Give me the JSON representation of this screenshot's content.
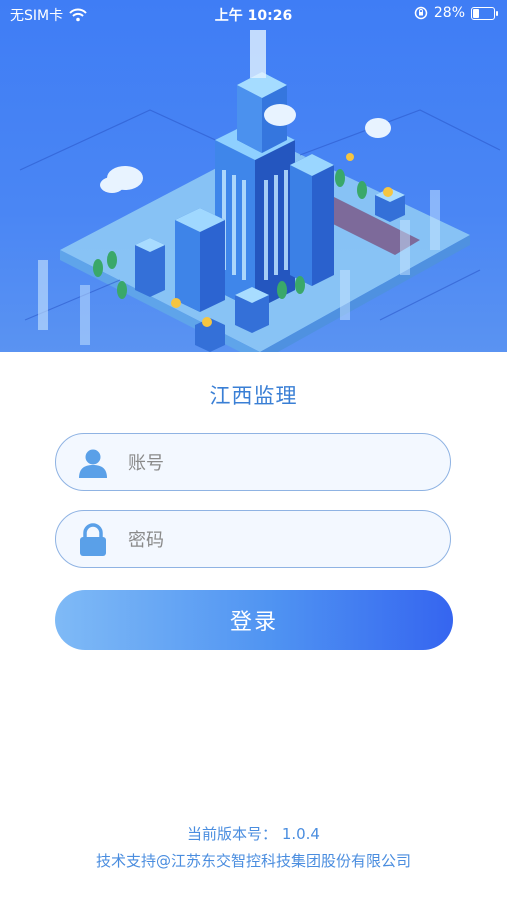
{
  "status_bar": {
    "carrier": "无SIM卡",
    "time": "上午 10:26",
    "battery_percent": "28%",
    "battery_level": 0.28,
    "icons": [
      "wifi-icon",
      "orientation-lock-icon",
      "battery-icon"
    ]
  },
  "app": {
    "title": "江西监理"
  },
  "form": {
    "account_placeholder": "账号",
    "password_placeholder": "密码",
    "login_label": "登录"
  },
  "footer": {
    "version_label": "当前版本号：",
    "version": "1.0.4",
    "support": "技术支持@江苏东交智控科技集团股份有限公司"
  },
  "colors": {
    "hero_blue": "#4a86f4",
    "accent": "#3a7fd5",
    "button_start": "#7fbaf6",
    "button_end": "#3565f0",
    "field_border": "#8fb3e3"
  }
}
